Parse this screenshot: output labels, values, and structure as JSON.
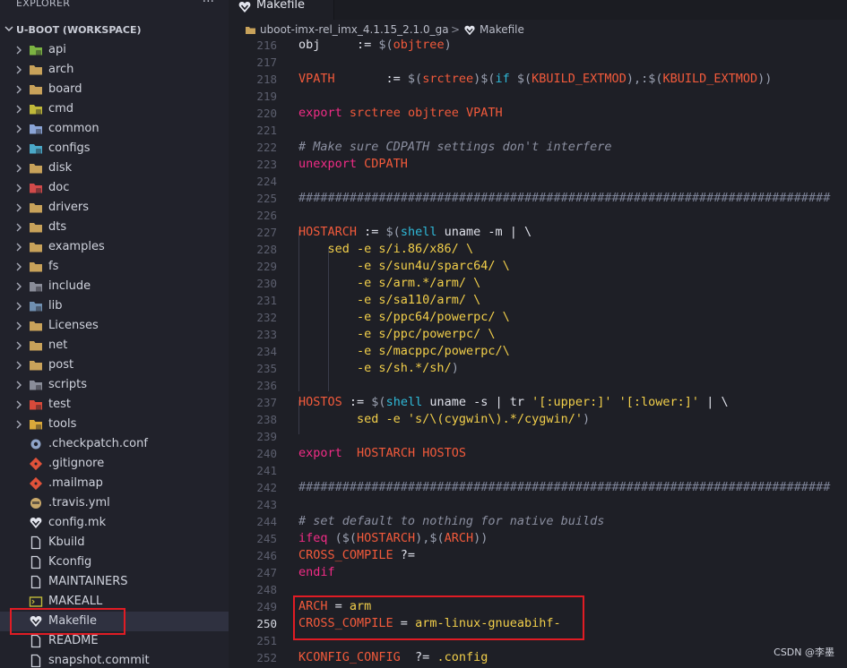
{
  "explorer": {
    "title": "EXPLORER",
    "more": "···",
    "workspace": "U-BOOT (WORKSPACE)",
    "items": [
      {
        "label": "api",
        "kind": "folder",
        "icon": "api-folder-icon",
        "color": "#7cb342"
      },
      {
        "label": "arch",
        "kind": "folder",
        "icon": "folder-icon",
        "color": "#c8a25a"
      },
      {
        "label": "board",
        "kind": "folder",
        "icon": "folder-icon",
        "color": "#c8a25a"
      },
      {
        "label": "cmd",
        "kind": "folder",
        "icon": "cmd-folder-icon",
        "color": "#c0b93a"
      },
      {
        "label": "common",
        "kind": "folder",
        "icon": "common-folder-icon",
        "color": "#8aa4d6"
      },
      {
        "label": "configs",
        "kind": "folder",
        "icon": "config-folder-icon",
        "color": "#4aa8c8"
      },
      {
        "label": "disk",
        "kind": "folder",
        "icon": "folder-icon",
        "color": "#c8a25a"
      },
      {
        "label": "doc",
        "kind": "folder",
        "icon": "doc-folder-icon",
        "color": "#d24a4a"
      },
      {
        "label": "drivers",
        "kind": "folder",
        "icon": "folder-icon",
        "color": "#c8a25a"
      },
      {
        "label": "dts",
        "kind": "folder",
        "icon": "folder-icon",
        "color": "#c8a25a"
      },
      {
        "label": "examples",
        "kind": "folder",
        "icon": "folder-icon",
        "color": "#c8a25a"
      },
      {
        "label": "fs",
        "kind": "folder",
        "icon": "folder-icon",
        "color": "#c8a25a"
      },
      {
        "label": "include",
        "kind": "folder",
        "icon": "include-folder-icon",
        "color": "#8a8d99"
      },
      {
        "label": "lib",
        "kind": "folder",
        "icon": "lib-folder-icon",
        "color": "#6f8fb0"
      },
      {
        "label": "Licenses",
        "kind": "folder",
        "icon": "folder-icon",
        "color": "#c8a25a"
      },
      {
        "label": "net",
        "kind": "folder",
        "icon": "folder-icon",
        "color": "#c8a25a"
      },
      {
        "label": "post",
        "kind": "folder",
        "icon": "folder-icon",
        "color": "#c8a25a"
      },
      {
        "label": "scripts",
        "kind": "folder",
        "icon": "scripts-folder-icon",
        "color": "#8a8d99"
      },
      {
        "label": "test",
        "kind": "folder",
        "icon": "test-folder-icon",
        "color": "#d84a3a"
      },
      {
        "label": "tools",
        "kind": "folder",
        "icon": "tools-folder-icon",
        "color": "#d9a83a"
      },
      {
        "label": ".checkpatch.conf",
        "kind": "file",
        "icon": "gear-file-icon",
        "color": "#8fa4c8"
      },
      {
        "label": ".gitignore",
        "kind": "file",
        "icon": "git-file-icon",
        "color": "#e0523a"
      },
      {
        "label": ".mailmap",
        "kind": "file",
        "icon": "git-file-icon",
        "color": "#e0523a"
      },
      {
        "label": ".travis.yml",
        "kind": "file",
        "icon": "travis-file-icon",
        "color": "#c9a86a"
      },
      {
        "label": "config.mk",
        "kind": "file",
        "icon": "makefile-icon",
        "color": "#e4e6ee"
      },
      {
        "label": "Kbuild",
        "kind": "file",
        "icon": "blank-file-icon",
        "color": "#cfd2dc"
      },
      {
        "label": "Kconfig",
        "kind": "file",
        "icon": "blank-file-icon",
        "color": "#cfd2dc"
      },
      {
        "label": "MAINTAINERS",
        "kind": "file",
        "icon": "blank-file-icon",
        "color": "#cfd2dc"
      },
      {
        "label": "MAKEALL",
        "kind": "file",
        "icon": "terminal-file-icon",
        "color": "#c0b93a"
      },
      {
        "label": "Makefile",
        "kind": "file",
        "icon": "makefile-icon",
        "color": "#e4e6ee",
        "selected": true
      },
      {
        "label": "README",
        "kind": "file",
        "icon": "blank-file-icon",
        "color": "#cfd2dc"
      },
      {
        "label": "snapshot.commit",
        "kind": "file",
        "icon": "blank-file-icon",
        "color": "#cfd2dc"
      }
    ]
  },
  "tabs": [
    {
      "label": "Makefile",
      "icon": "makefile-icon",
      "active": true
    }
  ],
  "breadcrumb": {
    "folder": "uboot-imx-rel_imx_4.1.15_2.1.0_ga",
    "separator": ">",
    "file": "Makefile"
  },
  "editor": {
    "active_line": 250,
    "lines": [
      {
        "n": 216,
        "tokens": [
          [
            "pl",
            "obj     := "
          ],
          [
            "pp",
            "$("
          ],
          [
            "var",
            "objtree"
          ],
          [
            "pp",
            ")"
          ]
        ]
      },
      {
        "n": 217,
        "tokens": []
      },
      {
        "n": 218,
        "tokens": [
          [
            "var",
            "VPATH"
          ],
          [
            "pl",
            "       := "
          ],
          [
            "pp",
            "$("
          ],
          [
            "var",
            "srctree"
          ],
          [
            "pp",
            ")$("
          ],
          [
            "fn",
            "if"
          ],
          [
            "pl",
            " "
          ],
          [
            "pp",
            "$("
          ],
          [
            "var",
            "KBUILD_EXTMOD"
          ],
          [
            "pp",
            "),:$("
          ],
          [
            "var",
            "KBUILD_EXTMOD"
          ],
          [
            "pp",
            "))"
          ]
        ]
      },
      {
        "n": 219,
        "tokens": []
      },
      {
        "n": 220,
        "tokens": [
          [
            "kw",
            "export"
          ],
          [
            "pl",
            " "
          ],
          [
            "var",
            "srctree objtree VPATH"
          ]
        ]
      },
      {
        "n": 221,
        "tokens": []
      },
      {
        "n": 222,
        "tokens": [
          [
            "cm",
            "# Make sure CDPATH settings don't interfere"
          ]
        ]
      },
      {
        "n": 223,
        "tokens": [
          [
            "kw",
            "unexport"
          ],
          [
            "pl",
            " "
          ],
          [
            "var",
            "CDPATH"
          ]
        ]
      },
      {
        "n": 224,
        "tokens": []
      },
      {
        "n": 225,
        "tokens": [
          [
            "hash",
            "#########################################################################"
          ]
        ]
      },
      {
        "n": 226,
        "tokens": []
      },
      {
        "n": 227,
        "tokens": [
          [
            "var",
            "HOSTARCH"
          ],
          [
            "pl",
            " := "
          ],
          [
            "pp",
            "$("
          ],
          [
            "fn",
            "shell"
          ],
          [
            "pl",
            " uname -m | \\"
          ]
        ]
      },
      {
        "n": 228,
        "tokens": [
          [
            "pl",
            "    "
          ],
          [
            "str",
            "sed -e s/i.86/x86/ \\"
          ]
        ]
      },
      {
        "n": 229,
        "tokens": [
          [
            "pl",
            "        "
          ],
          [
            "str",
            "-e s/sun4u/sparc64/ \\"
          ]
        ]
      },
      {
        "n": 230,
        "tokens": [
          [
            "pl",
            "        "
          ],
          [
            "str",
            "-e s/arm.*/arm/ \\"
          ]
        ]
      },
      {
        "n": 231,
        "tokens": [
          [
            "pl",
            "        "
          ],
          [
            "str",
            "-e s/sa110/arm/ \\"
          ]
        ]
      },
      {
        "n": 232,
        "tokens": [
          [
            "pl",
            "        "
          ],
          [
            "str",
            "-e s/ppc64/powerpc/ \\"
          ]
        ]
      },
      {
        "n": 233,
        "tokens": [
          [
            "pl",
            "        "
          ],
          [
            "str",
            "-e s/ppc/powerpc/ \\"
          ]
        ]
      },
      {
        "n": 234,
        "tokens": [
          [
            "pl",
            "        "
          ],
          [
            "str",
            "-e s/macppc/powerpc/\\"
          ]
        ]
      },
      {
        "n": 235,
        "tokens": [
          [
            "pl",
            "        "
          ],
          [
            "str",
            "-e s/sh.*/sh/"
          ],
          [
            "pp",
            ")"
          ]
        ]
      },
      {
        "n": 236,
        "tokens": []
      },
      {
        "n": 237,
        "tokens": [
          [
            "var",
            "HOSTOS"
          ],
          [
            "pl",
            " := "
          ],
          [
            "pp",
            "$("
          ],
          [
            "fn",
            "shell"
          ],
          [
            "pl",
            " uname -s | tr "
          ],
          [
            "str",
            "'[:upper:]' '[:lower:]'"
          ],
          [
            "pl",
            " | \\"
          ]
        ]
      },
      {
        "n": 238,
        "tokens": [
          [
            "pl",
            "        "
          ],
          [
            "str",
            "sed -e 's/\\(cygwin\\).*/cygwin/'"
          ],
          [
            "pp",
            ")"
          ]
        ]
      },
      {
        "n": 239,
        "tokens": []
      },
      {
        "n": 240,
        "tokens": [
          [
            "kw",
            "export"
          ],
          [
            "pl",
            "  "
          ],
          [
            "var",
            "HOSTARCH HOSTOS"
          ]
        ]
      },
      {
        "n": 241,
        "tokens": []
      },
      {
        "n": 242,
        "tokens": [
          [
            "hash",
            "#########################################################################"
          ]
        ]
      },
      {
        "n": 243,
        "tokens": []
      },
      {
        "n": 244,
        "tokens": [
          [
            "cm",
            "# set default to nothing for native builds"
          ]
        ]
      },
      {
        "n": 245,
        "tokens": [
          [
            "kw",
            "ifeq"
          ],
          [
            "pl",
            " "
          ],
          [
            "pp",
            "($("
          ],
          [
            "var",
            "HOSTARCH"
          ],
          [
            "pp",
            "),$("
          ],
          [
            "var",
            "ARCH"
          ],
          [
            "pp",
            "))"
          ]
        ]
      },
      {
        "n": 246,
        "tokens": [
          [
            "var",
            "CROSS_COMPILE"
          ],
          [
            "pl",
            " ?="
          ]
        ]
      },
      {
        "n": 247,
        "tokens": [
          [
            "kw",
            "endif"
          ]
        ]
      },
      {
        "n": 248,
        "tokens": []
      },
      {
        "n": 249,
        "tokens": [
          [
            "var",
            "ARCH"
          ],
          [
            "pl",
            " = "
          ],
          [
            "str",
            "arm"
          ]
        ]
      },
      {
        "n": 250,
        "tokens": [
          [
            "var",
            "CROSS_COMPILE"
          ],
          [
            "pl",
            " = "
          ],
          [
            "str",
            "arm-linux-gnueabihf-"
          ]
        ]
      },
      {
        "n": 251,
        "tokens": []
      },
      {
        "n": 252,
        "tokens": [
          [
            "var",
            "KCONFIG_CONFIG"
          ],
          [
            "pl",
            "  ?= "
          ],
          [
            "str",
            ".config"
          ]
        ]
      }
    ]
  },
  "watermark": "CSDN @李墨",
  "colors": {
    "keyword": "#f22c86",
    "variable": "#f25a3b",
    "function": "#2fb9d8",
    "string": "#f2cf4a",
    "comment": "#8b8fa0",
    "annotation_box": "#e01c24"
  }
}
